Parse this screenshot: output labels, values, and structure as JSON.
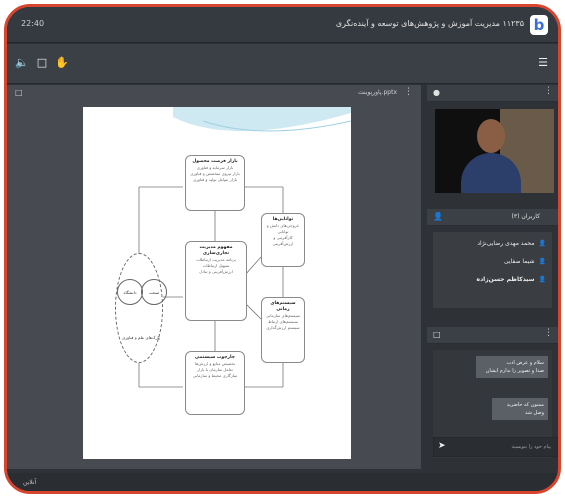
{
  "window": {
    "time": "22:40",
    "title": "۱۱۲۳۵ مدیریت آموزش و پژوهش‌های توسعه و آینده‌نگری"
  },
  "toolbar": {
    "icons": [
      "speaker-icon",
      "document-icon",
      "hand-icon"
    ],
    "menu_icon": "hamburger-icon"
  },
  "presentation": {
    "filename": "پاورپوینت.pptx",
    "slide": {
      "boxes": [
        {
          "title": "بازار فرصت محصول",
          "lines": [
            "بازار سرمایه و فناوری",
            "بازار نیروی متخصص و فناوری",
            "بازار عوامل تولید و فناوری"
          ]
        },
        {
          "title": "مفهوم مدیریت تجاری‌سازی",
          "lines": [
            "برنامه مدیریت ارتباطات",
            "تسهیل ارتباطات",
            "ارزش‌آفرینی و تبادل"
          ]
        },
        {
          "title": "توانایی‌ها",
          "lines": [
            "خروجی‌های دانش و توانایی",
            "کارآفرینی و ارزش‌آفرینی"
          ]
        },
        {
          "title": "سیستم‌های زمانی",
          "lines": [
            "سیستم‌های سازمانی",
            "سیستم‌های ارتباط",
            "سیستم ارزش‌گذاری"
          ]
        },
        {
          "title": "چارچوب سیستمی",
          "lines": [
            "تخصیص منابع و ارزش‌ها",
            "تعامل سازمان با بازار",
            "سازگاری محیط و سازمانی"
          ]
        }
      ],
      "circles": [
        "دانشگاه",
        "صنعت",
        "پارک‌های علم و فناوری"
      ]
    }
  },
  "video_panel": {
    "icon": "camera-icon"
  },
  "users_panel": {
    "label": "کاربران (۳)",
    "users": [
      {
        "name": "محمد مهدی رضایی‌نژاد"
      },
      {
        "name": "شیما صفایی"
      },
      {
        "name": "سیدکاظم حسن‌زاده"
      }
    ]
  },
  "chat_panel": {
    "messages": [
      {
        "line1": "سلام و عرض ادب",
        "line2": "صدا و تصویر را ندارم ایشان"
      },
      {
        "line1": "ممنون که حاضرید",
        "line2": "وصل شد"
      }
    ],
    "input_placeholder": "پیام خود را بنویسید"
  },
  "status": {
    "text": "آنلاین"
  },
  "colors": {
    "frame_border": "#d8452f",
    "background": "#2e3236",
    "toolbar": "#3b4046",
    "accent": "#5aa8ff"
  }
}
